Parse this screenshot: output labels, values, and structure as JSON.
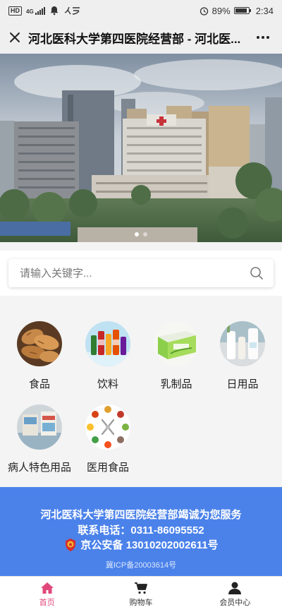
{
  "status_bar": {
    "hd_label": "HD",
    "network_label": "4G",
    "battery": "89%",
    "time": "2:34"
  },
  "title_bar": {
    "title": "河北医科大学第四医院经营部 - 河北医..."
  },
  "banner": {
    "slide_count": 2,
    "active_slide": 0
  },
  "search": {
    "placeholder": "请输入关键字..."
  },
  "categories": [
    {
      "label": "食品",
      "icon": "bread-image"
    },
    {
      "label": "饮料",
      "icon": "drinks-image"
    },
    {
      "label": "乳制品",
      "icon": "milk-carton-image"
    },
    {
      "label": "日用品",
      "icon": "daily-goods-image"
    },
    {
      "label": "病人特色用品",
      "icon": "patient-supplies-image"
    },
    {
      "label": "医用食品",
      "icon": "medical-food-image"
    }
  ],
  "footer": {
    "line1": "河北医科大学第四医院经营部竭诚为您服务",
    "line2": "联系电话：0311-86095552",
    "police_record": "京公安备 13010202002611号",
    "icp": "冀ICP备20003614号"
  },
  "tabbar": {
    "items": [
      {
        "label": "首页",
        "icon": "home-icon",
        "active": true
      },
      {
        "label": "购物车",
        "icon": "cart-icon",
        "active": false
      },
      {
        "label": "会员中心",
        "icon": "user-icon",
        "active": false
      }
    ]
  },
  "colors": {
    "footer_bg": "#4b82ea",
    "active_tab": "#e0487a"
  }
}
